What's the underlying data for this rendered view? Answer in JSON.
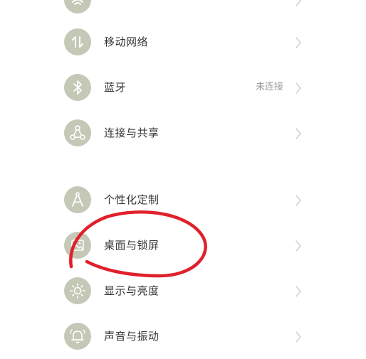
{
  "settings": {
    "items": [
      {
        "label": "",
        "value": "",
        "icon": "wifi-icon"
      },
      {
        "label": "移动网络",
        "value": "",
        "icon": "mobile-data-icon"
      },
      {
        "label": "蓝牙",
        "value": "未连接",
        "icon": "bluetooth-icon"
      },
      {
        "label": "连接与共享",
        "value": "",
        "icon": "share-icon"
      },
      {
        "label": "个性化定制",
        "value": "",
        "icon": "compass-icon"
      },
      {
        "label": "桌面与锁屏",
        "value": "",
        "icon": "image-icon"
      },
      {
        "label": "显示与亮度",
        "value": "",
        "icon": "brightness-icon"
      },
      {
        "label": "声音与振动",
        "value": "",
        "icon": "bell-icon"
      }
    ]
  },
  "colors": {
    "icon_background": "#c4c8b6",
    "annotation_stroke": "#e0202a",
    "chevron": "#cfcfcf"
  }
}
